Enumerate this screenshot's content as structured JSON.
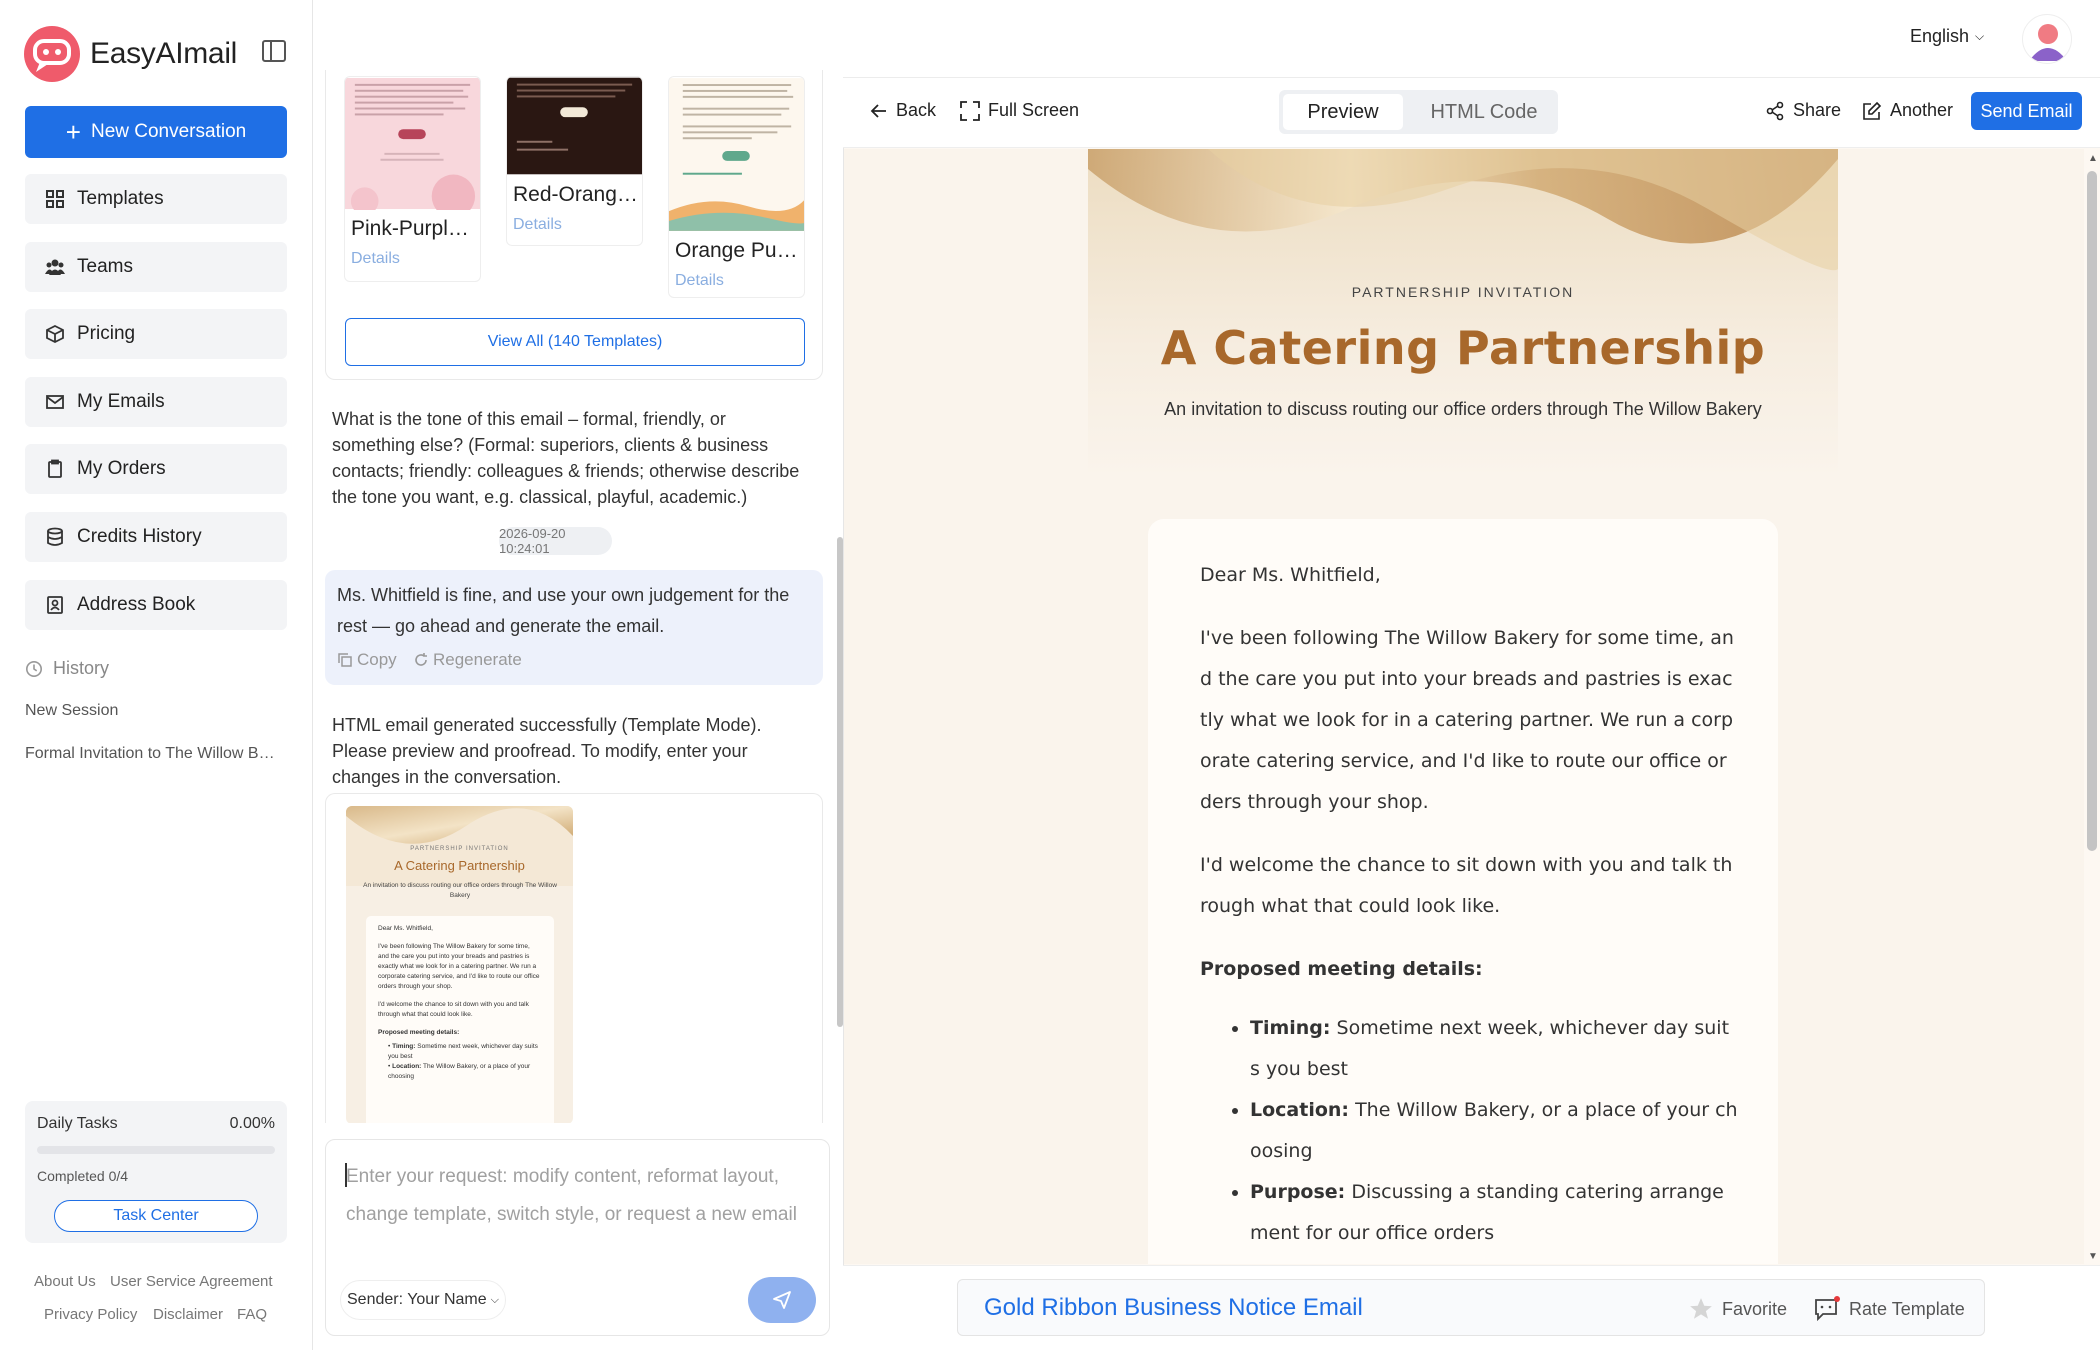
{
  "app": {
    "name": "EasyAImail"
  },
  "sidebar": {
    "new_conversation": "New Conversation",
    "items": [
      {
        "label": "Templates",
        "icon": "grid-icon"
      },
      {
        "label": "Teams",
        "icon": "users-icon"
      },
      {
        "label": "Pricing",
        "icon": "cube-icon"
      },
      {
        "label": "My Emails",
        "icon": "mail-icon"
      },
      {
        "label": "My Orders",
        "icon": "clipboard-icon"
      },
      {
        "label": "Credits History",
        "icon": "database-icon"
      },
      {
        "label": "Address Book",
        "icon": "contact-book-icon"
      }
    ],
    "history": {
      "title": "History",
      "items": [
        "New Session",
        "Formal Invitation to The Willow B…"
      ]
    },
    "tasks": {
      "label": "Daily Tasks",
      "percent": "0.00%",
      "progress": 0,
      "completed": "Completed 0/4",
      "button": "Task Center"
    },
    "footer_links": [
      "About Us",
      "User Service Agreement",
      "Privacy Policy",
      "Disclaimer",
      "FAQ"
    ]
  },
  "chat": {
    "templates": [
      {
        "name": "Pink-Purpl…",
        "details": "Details"
      },
      {
        "name": "Red-Orang…",
        "details": "Details"
      },
      {
        "name": "Orange Pu…",
        "details": "Details"
      }
    ],
    "view_all": "View All (140 Templates)",
    "bot_question": "What is the tone of this email – formal, friendly, or something else? (Formal: superiors, clients & business contacts; friendly: colleagues & friends; otherwise describe the tone you want, e.g. classical, playful, academic.)",
    "timestamp": "2026-09-20 10:24:01",
    "user_message": "Ms. Whitfield is fine, and use your own judgement for the rest — go ahead and generate the email.",
    "copy": "Copy",
    "regenerate": "Regenerate",
    "bot_result": "HTML email generated successfully (Template Mode). Please preview and proofread. To modify, enter your changes in the conversation.",
    "input_placeholder": "Enter your request: modify content, reformat layout, change template, switch style, or request a new email",
    "sender": "Sender: Your Name"
  },
  "topbar": {
    "language": "English"
  },
  "toolbar": {
    "back": "Back",
    "fullscreen": "Full Screen",
    "tab_preview": "Preview",
    "tab_html": "HTML Code",
    "share": "Share",
    "another": "Another",
    "send_email": "Send Email"
  },
  "email": {
    "label": "PARTNERSHIP INVITATION",
    "title": "A Catering Partnership",
    "subtitle": "An invitation to discuss routing our office orders through The Willow Bakery",
    "greeting": "Dear Ms. Whitfield,",
    "para1": "I've been following The Willow Bakery for some time, and the care you put into your breads and pastries is exactly what we look for in a catering partner. We run a corporate catering service, and I'd like to route our office orders through your shop.",
    "para2": "I'd welcome the chance to sit down with you and talk through what that could look like.",
    "details_heading": "Proposed meeting details:",
    "details": [
      {
        "label": "Timing:",
        "text": " Sometime next week, whichever day suits you best"
      },
      {
        "label": "Location:",
        "text": " The Willow Bakery, or a place of your choosing"
      },
      {
        "label": "Purpose:",
        "text": " Discussing a standing catering arrangement for our office orders"
      }
    ]
  },
  "bottom": {
    "template_name": "Gold Ribbon Business Notice Email",
    "favorite": "Favorite",
    "rate": "Rate Template"
  },
  "colors": {
    "accent": "#1f6fe5",
    "title_gold": "#a8682b",
    "logo": "#ef5b6b"
  }
}
